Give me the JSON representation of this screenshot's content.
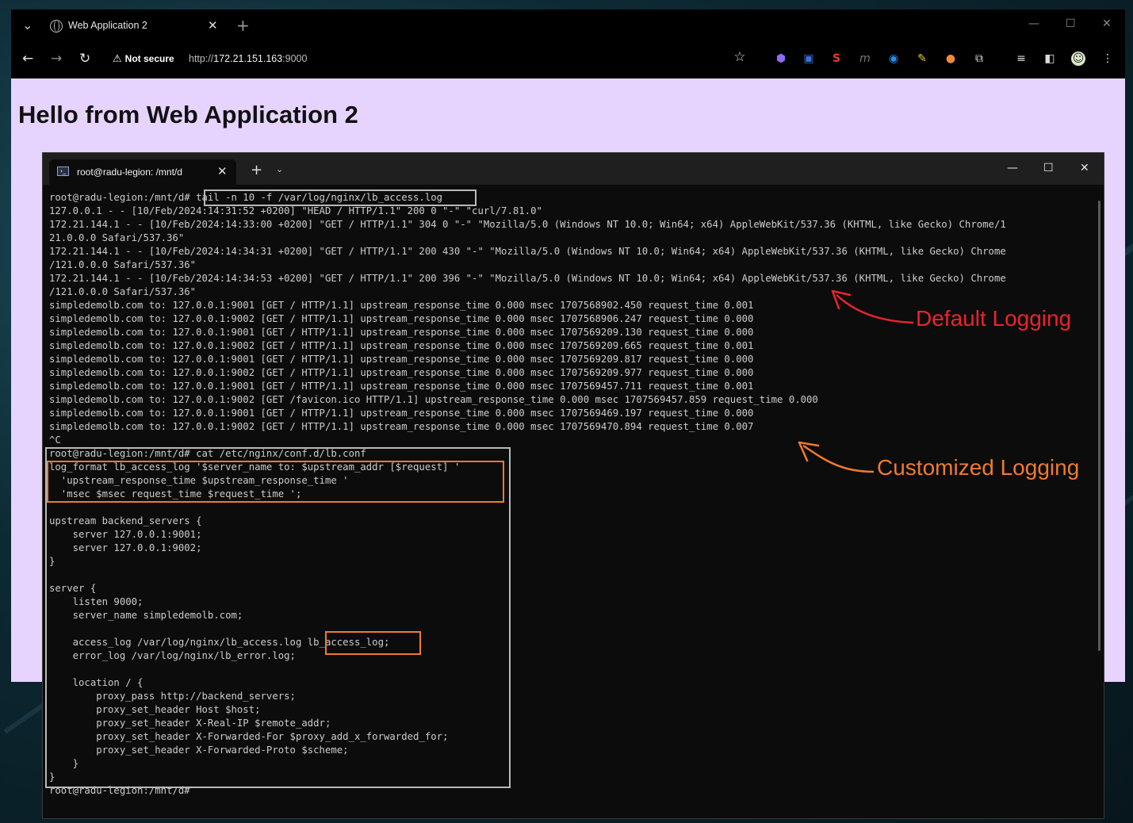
{
  "browser": {
    "tab_title": "Web Application 2",
    "security_label": "Not secure",
    "url_scheme": "http://",
    "url_host": "172.21.151.163",
    "url_port": ":9000"
  },
  "page": {
    "heading": "Hello from Web Application 2"
  },
  "terminal": {
    "tab_title": "root@radu-legion: /mnt/d",
    "lines": [
      "root@radu-legion:/mnt/d# tail -n 10 -f /var/log/nginx/lb_access.log",
      "127.0.0.1 - - [10/Feb/2024:14:31:52 +0200] \"HEAD / HTTP/1.1\" 200 0 \"-\" \"curl/7.81.0\"",
      "172.21.144.1 - - [10/Feb/2024:14:33:00 +0200] \"GET / HTTP/1.1\" 304 0 \"-\" \"Mozilla/5.0 (Windows NT 10.0; Win64; x64) AppleWebKit/537.36 (KHTML, like Gecko) Chrome/1",
      "21.0.0.0 Safari/537.36\"",
      "172.21.144.1 - - [10/Feb/2024:14:34:31 +0200] \"GET / HTTP/1.1\" 200 430 \"-\" \"Mozilla/5.0 (Windows NT 10.0; Win64; x64) AppleWebKit/537.36 (KHTML, like Gecko) Chrome",
      "/121.0.0.0 Safari/537.36\"",
      "172.21.144.1 - - [10/Feb/2024:14:34:53 +0200] \"GET / HTTP/1.1\" 200 396 \"-\" \"Mozilla/5.0 (Windows NT 10.0; Win64; x64) AppleWebKit/537.36 (KHTML, like Gecko) Chrome",
      "/121.0.0.0 Safari/537.36\"",
      "simpledemolb.com to: 127.0.0.1:9001 [GET / HTTP/1.1] upstream_response_time 0.000 msec 1707568902.450 request_time 0.001",
      "simpledemolb.com to: 127.0.0.1:9002 [GET / HTTP/1.1] upstream_response_time 0.000 msec 1707568906.247 request_time 0.000",
      "simpledemolb.com to: 127.0.0.1:9001 [GET / HTTP/1.1] upstream_response_time 0.000 msec 1707569209.130 request_time 0.000",
      "simpledemolb.com to: 127.0.0.1:9002 [GET / HTTP/1.1] upstream_response_time 0.000 msec 1707569209.665 request_time 0.001",
      "simpledemolb.com to: 127.0.0.1:9001 [GET / HTTP/1.1] upstream_response_time 0.000 msec 1707569209.817 request_time 0.000",
      "simpledemolb.com to: 127.0.0.1:9002 [GET / HTTP/1.1] upstream_response_time 0.000 msec 1707569209.977 request_time 0.000",
      "simpledemolb.com to: 127.0.0.1:9001 [GET / HTTP/1.1] upstream_response_time 0.000 msec 1707569457.711 request_time 0.001",
      "simpledemolb.com to: 127.0.0.1:9002 [GET /favicon.ico HTTP/1.1] upstream_response_time 0.000 msec 1707569457.859 request_time 0.000",
      "simpledemolb.com to: 127.0.0.1:9001 [GET / HTTP/1.1] upstream_response_time 0.000 msec 1707569469.197 request_time 0.000",
      "simpledemolb.com to: 127.0.0.1:9002 [GET / HTTP/1.1] upstream_response_time 0.000 msec 1707569470.894 request_time 0.007",
      "^C",
      "root@radu-legion:/mnt/d# cat /etc/nginx/conf.d/lb.conf",
      "log_format lb_access_log '$server_name to: $upstream_addr [$request] '",
      "  'upstream_response_time $upstream_response_time '",
      "  'msec $msec request_time $request_time ';",
      "",
      "upstream backend_servers {",
      "    server 127.0.0.1:9001;",
      "    server 127.0.0.1:9002;",
      "}",
      "",
      "server {",
      "    listen 9000;",
      "    server_name simpledemolb.com;",
      "",
      "    access_log /var/log/nginx/lb_access.log lb_access_log;",
      "    error_log /var/log/nginx/lb_error.log;",
      "",
      "    location / {",
      "        proxy_pass http://backend_servers;",
      "        proxy_set_header Host $host;",
      "        proxy_set_header X-Real-IP $remote_addr;",
      "        proxy_set_header X-Forwarded-For $proxy_add_x_forwarded_for;",
      "        proxy_set_header X-Forwarded-Proto $scheme;",
      "    }",
      "}",
      "root@radu-legion:/mnt/d#"
    ]
  },
  "annotations": {
    "default_label": "Default Logging",
    "default_color": "#e8252c",
    "custom_label": "Customized Logging",
    "custom_color": "#f07a2e"
  }
}
